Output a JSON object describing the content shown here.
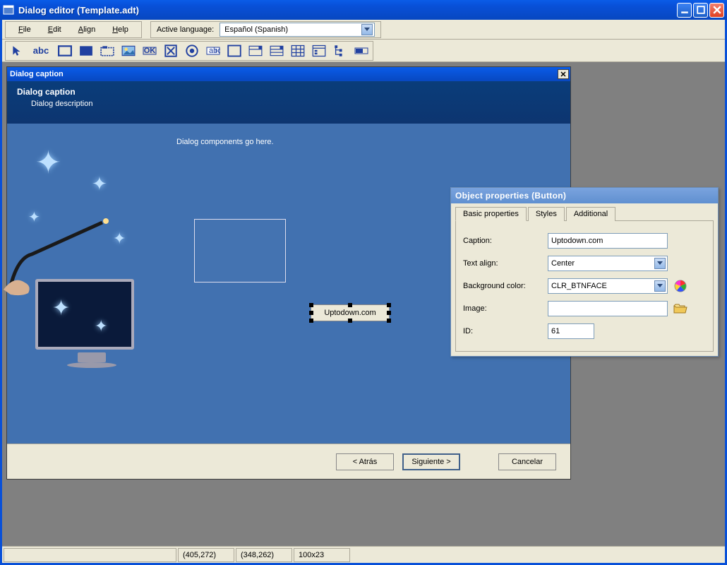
{
  "window": {
    "title": "Dialog editor (Template.adt)"
  },
  "menu": {
    "file": "File",
    "edit": "Edit",
    "align": "Align",
    "help": "Help"
  },
  "language": {
    "label": "Active language:",
    "value": "Español (Spanish)"
  },
  "dialog": {
    "titlebar": "Dialog caption",
    "header_title": "Dialog caption",
    "header_desc": "Dialog description",
    "body_hint": "Dialog components go here.",
    "selected_button_text": "Uptodown.com",
    "buttons": {
      "back": "< Atrás",
      "next": "Siguiente >",
      "cancel": "Cancelar"
    }
  },
  "properties": {
    "panel_title": "Object properties (Button)",
    "tabs": {
      "basic": "Basic properties",
      "styles": "Styles",
      "additional": "Additional"
    },
    "fields": {
      "caption_label": "Caption:",
      "caption_value": "Uptodown.com",
      "textalign_label": "Text align:",
      "textalign_value": "Center",
      "bgcolor_label": "Background color:",
      "bgcolor_value": "CLR_BTNFACE",
      "image_label": "Image:",
      "image_value": "",
      "id_label": "ID:",
      "id_value": "61"
    }
  },
  "statusbar": {
    "coord1": "(405,272)",
    "coord2": "(348,262)",
    "size": "100x23"
  }
}
